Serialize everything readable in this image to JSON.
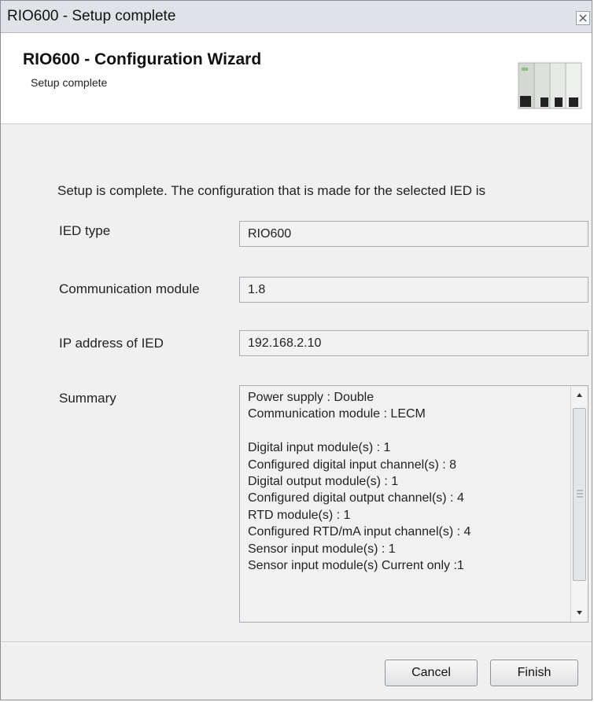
{
  "window": {
    "title": "RIO600 - Setup complete",
    "close_label": "close"
  },
  "header": {
    "title": "RIO600 - Configuration Wizard",
    "subtitle": "Setup complete",
    "image_icon": "device-photo"
  },
  "intro": "Setup is complete. The configuration that is made for the selected IED is",
  "fields": {
    "ied_type": {
      "label": "IED type",
      "value": "RIO600"
    },
    "comm_module": {
      "label": "Communication module",
      "value": "1.8"
    },
    "ip_address": {
      "label": "IP address of IED",
      "value": "192.168.2.10"
    }
  },
  "summary": {
    "label": "Summary",
    "lines": [
      "Power supply : Double",
      "Communication module : LECM",
      "",
      "Digital input module(s) : 1",
      "Configured digital input channel(s) : 8",
      "Digital output module(s) : 1",
      "Configured digital output channel(s) : 4",
      "RTD module(s) : 1",
      "Configured RTD/mA input channel(s) : 4",
      "Sensor input module(s) : 1",
      "Sensor input module(s) Current only :1"
    ]
  },
  "buttons": {
    "cancel": "Cancel",
    "finish": "Finish"
  }
}
